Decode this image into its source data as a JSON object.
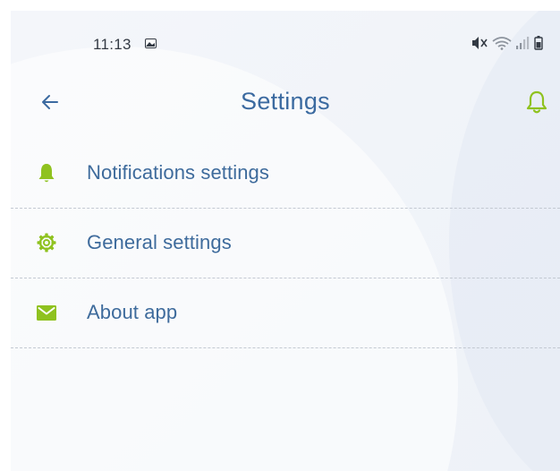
{
  "status_bar": {
    "time": "11:13",
    "icons": [
      "gallery-icon",
      "mute-icon",
      "wifi-icon",
      "signal-icon",
      "battery-icon"
    ]
  },
  "app_bar": {
    "title": "Settings",
    "back_icon": "arrow-left-icon",
    "action_icon": "bell-outline-icon"
  },
  "settings": {
    "items": [
      {
        "label": "Notifications settings",
        "icon": "bell-icon"
      },
      {
        "label": "General settings",
        "icon": "gear-icon"
      },
      {
        "label": "About app",
        "icon": "envelope-icon"
      }
    ]
  },
  "colors": {
    "accent_green": "#8fc21f",
    "title_blue": "#3b6aa0",
    "label_blue": "#3e6b9c",
    "divider": "#c3c9d2",
    "status_dark": "#333a44"
  }
}
